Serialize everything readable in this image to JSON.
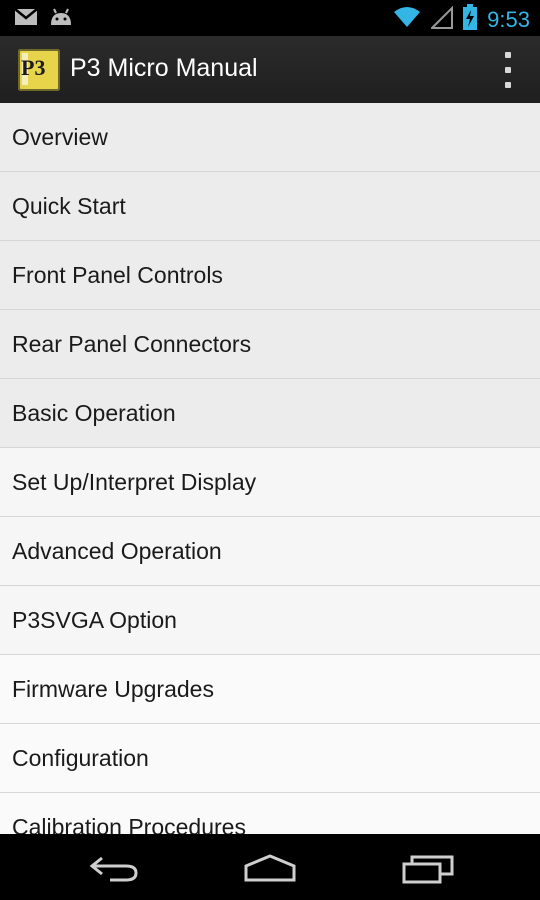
{
  "status_bar": {
    "time": "9:53",
    "icons": [
      "gmail-icon",
      "android-debug-icon",
      "wifi-icon",
      "signal-icon",
      "battery-charging-icon"
    ],
    "accent_color": "#33b5e5"
  },
  "action_bar": {
    "title": "P3 Micro Manual",
    "app_icon_text": "P3",
    "overflow_icon": "overflow-menu-icon"
  },
  "menu": {
    "items": [
      {
        "label": "Overview"
      },
      {
        "label": "Quick Start"
      },
      {
        "label": "Front Panel Controls"
      },
      {
        "label": "Rear Panel Connectors"
      },
      {
        "label": "Basic Operation"
      },
      {
        "label": "Set Up/Interpret Display"
      },
      {
        "label": "Advanced Operation"
      },
      {
        "label": "P3SVGA Option"
      },
      {
        "label": "Firmware Upgrades"
      },
      {
        "label": "Configuration"
      },
      {
        "label": "Calibration Procedures"
      }
    ]
  },
  "nav_bar": {
    "icons": [
      "back-icon",
      "home-icon",
      "recents-icon"
    ]
  }
}
